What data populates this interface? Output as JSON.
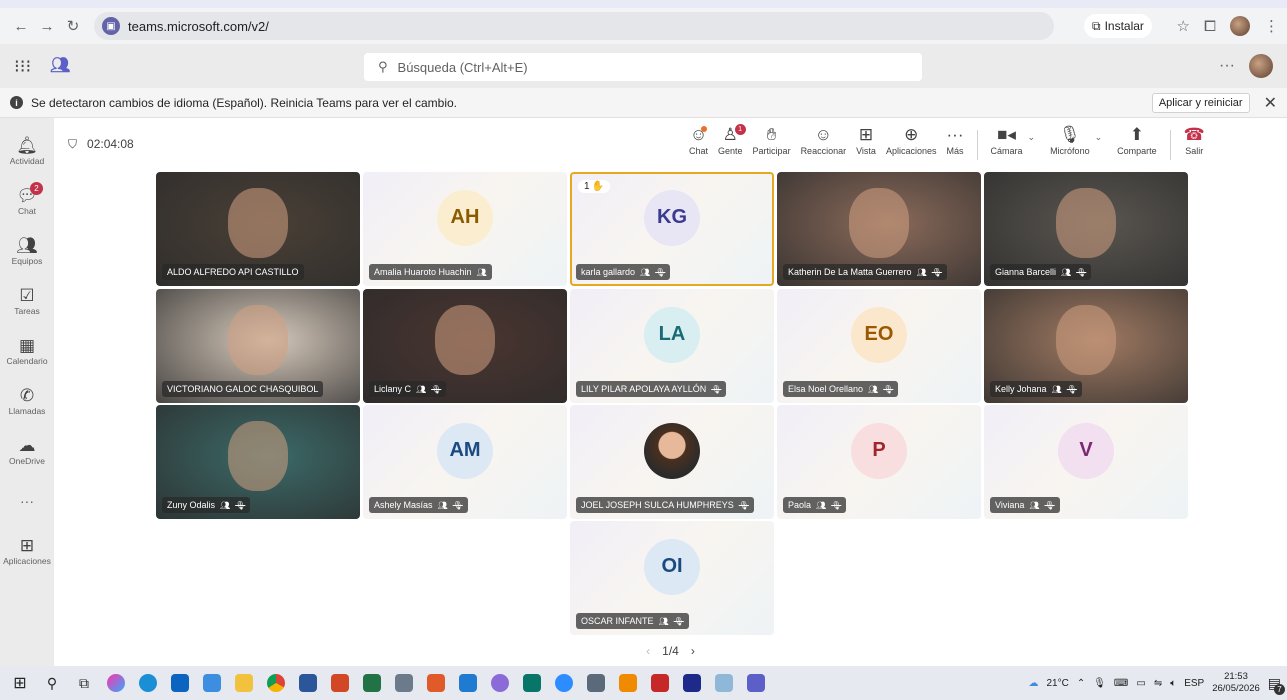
{
  "browser": {
    "url": "teams.microsoft.com/v2/",
    "install_label": "Instalar"
  },
  "header": {
    "search_placeholder": "Búsqueda (Ctrl+Alt+E)",
    "more": "···"
  },
  "notice": {
    "text": "Se detectaron cambios de idioma (Español). Reinicia Teams para ver el cambio.",
    "apply_label": "Aplicar y reiniciar"
  },
  "rail": [
    {
      "label": "Actividad",
      "icon": "bell-icon",
      "glyph": "🔔︎",
      "badge": ""
    },
    {
      "label": "Chat",
      "icon": "chat-icon",
      "glyph": "💬︎",
      "badge": "2"
    },
    {
      "label": "Equipos",
      "icon": "teams-icon",
      "glyph": "👥︎",
      "badge": ""
    },
    {
      "label": "Tareas",
      "icon": "tasks-icon",
      "glyph": "☑",
      "badge": ""
    },
    {
      "label": "Calendario",
      "icon": "calendar-icon",
      "glyph": "▦",
      "badge": ""
    },
    {
      "label": "Llamadas",
      "icon": "phone-icon",
      "glyph": "✆",
      "badge": ""
    },
    {
      "label": "OneDrive",
      "icon": "cloud-icon",
      "glyph": "☁",
      "badge": ""
    },
    {
      "label": "···",
      "icon": "more-icon",
      "glyph": "",
      "badge": ""
    },
    {
      "label": "Aplicaciones",
      "icon": "apps-icon",
      "glyph": "⊞",
      "badge": ""
    }
  ],
  "meeting": {
    "timer": "02:04:08",
    "tools": [
      {
        "label": "Chat",
        "icon": "chat-icon",
        "glyph": "☺",
        "badge": "",
        "dot": true
      },
      {
        "label": "Gente",
        "icon": "people-icon",
        "glyph": "♙",
        "badge": "1",
        "dot": false
      },
      {
        "label": "Participar",
        "icon": "raise-hand-icon",
        "glyph": "✋︎",
        "badge": "",
        "dot": false
      },
      {
        "label": "Reaccionar",
        "icon": "react-icon",
        "glyph": "☺",
        "badge": "",
        "dot": false
      },
      {
        "label": "Vista",
        "icon": "view-icon",
        "glyph": "⊞",
        "badge": "",
        "dot": false
      },
      {
        "label": "Aplicaciones",
        "icon": "apps-icon",
        "glyph": "⊕",
        "badge": "",
        "dot": false
      },
      {
        "label": "Más",
        "icon": "more-icon",
        "glyph": "···",
        "badge": "",
        "dot": false
      }
    ],
    "camera_label": "Cámara",
    "mic_label": "Micrófono",
    "share_label": "Comparte",
    "leave_label": "Salir"
  },
  "participants": [
    {
      "name": "ALDO ALFREDO API CASTILLO",
      "type": "video",
      "bg": "#4a4036",
      "muted": false
    },
    {
      "name": "Amalia Huaroto Huachin",
      "type": "initials",
      "initials": "AH",
      "color": "#fbeed0",
      "text": "#8a5a00",
      "muted": false
    },
    {
      "name": "karla gallardo",
      "type": "initials",
      "initials": "KG",
      "color": "#e8e6f5",
      "text": "#3b3a8f",
      "muted": true,
      "hand": "1",
      "speaking": true
    },
    {
      "name": "Katherin De La Matta Guerrero",
      "type": "video",
      "bg": "#8a6a5a",
      "muted": true
    },
    {
      "name": "Gianna Barcelli",
      "type": "video",
      "bg": "#5a5650",
      "muted": true
    },
    {
      "name": "VICTORIANO GALOC CHASQUIBOL",
      "type": "video",
      "bg": "#d6c9bb",
      "muted": false
    },
    {
      "name": "Liclany C",
      "type": "video",
      "bg": "#4a3530",
      "muted": true
    },
    {
      "name": "LILY PILAR APOLAYA AYLLÓN",
      "type": "initials",
      "initials": "LA",
      "color": "#d8eef0",
      "text": "#1a6b75",
      "muted": true
    },
    {
      "name": "Elsa Noel Orellano",
      "type": "initials",
      "initials": "EO",
      "color": "#fbe8cc",
      "text": "#9a5800",
      "muted": true
    },
    {
      "name": "Kelly Johana",
      "type": "video",
      "bg": "#a07a62",
      "muted": true
    },
    {
      "name": "Zuny Odalis",
      "type": "video",
      "bg": "#3b6a68",
      "muted": true
    },
    {
      "name": "Ashely Masías",
      "type": "initials",
      "initials": "AM",
      "color": "#dde8f5",
      "text": "#1b4a80",
      "muted": true
    },
    {
      "name": "JOEL JOSEPH SULCA HUMPHREYS",
      "type": "photo",
      "muted": true
    },
    {
      "name": "Paola",
      "type": "initials",
      "initials": "P",
      "color": "#f8dede",
      "text": "#a0262e",
      "muted": true
    },
    {
      "name": "Viviana",
      "type": "initials",
      "initials": "V",
      "color": "#f2dff0",
      "text": "#7a2a70",
      "muted": true
    },
    {
      "name": "OSCAR INFANTE",
      "type": "initials",
      "initials": "OI",
      "color": "#dde8f5",
      "text": "#1b4a80",
      "muted": true
    }
  ],
  "pager": "1/4",
  "taskbar": {
    "temp": "21°C",
    "lang": "ESP",
    "time": "21:53",
    "date": "26/05/2026",
    "notif": "7"
  }
}
